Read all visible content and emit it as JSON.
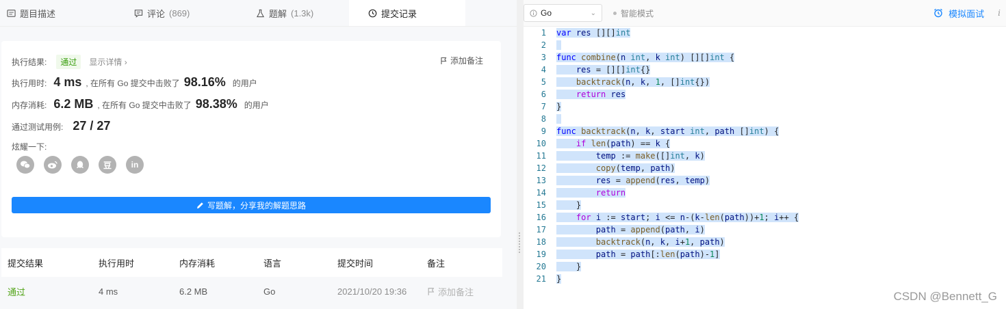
{
  "tabs": [
    {
      "label": "题目描述",
      "count": ""
    },
    {
      "label": "评论",
      "count": "(869)"
    },
    {
      "label": "题解",
      "count": "(1.3k)"
    },
    {
      "label": "提交记录",
      "count": ""
    }
  ],
  "result": {
    "result_label": "执行结果:",
    "result_value": "通过",
    "detail_link": "显示详情 ›",
    "add_note": "添加备注",
    "runtime_label": "执行用时:",
    "runtime_value": "4 ms",
    "runtime_text": ", 在所有 Go 提交中击败了",
    "runtime_percent": "98.16%",
    "runtime_suffix": "的用户",
    "memory_label": "内存消耗:",
    "memory_value": "6.2 MB",
    "memory_text": ", 在所有 Go 提交中击败了",
    "memory_percent": "98.38%",
    "memory_suffix": "的用户",
    "tests_label": "通过测试用例:",
    "tests_value": "27 / 27",
    "share_label": "炫耀一下:",
    "share_icons": [
      "wechat-icon",
      "weibo-icon",
      "qq-icon",
      "douban-icon",
      "linkedin-icon"
    ],
    "douban_glyph": "豆",
    "linkedin_glyph": "in",
    "write_button": "写题解，分享我的解题思路"
  },
  "table": {
    "headers": [
      "提交结果",
      "执行用时",
      "内存消耗",
      "语言",
      "提交时间",
      "备注"
    ],
    "rows": [
      {
        "result": "通过",
        "runtime": "4 ms",
        "memory": "6.2 MB",
        "language": "Go",
        "time": "2021/10/20 19:36",
        "note": "添加备注"
      }
    ]
  },
  "editor": {
    "language": "Go",
    "smart_mode": "智能模式",
    "mock_interview": "模拟面试",
    "info": "i"
  },
  "code_lines": [
    "var res [][]int",
    "",
    "func combine(n int, k int) [][]int {",
    "    res = [][]int{}",
    "    backtrack(n, k, 1, []int{})",
    "    return res",
    "}",
    "",
    "func backtrack(n, k, start int, path []int) {",
    "    if len(path) == k {",
    "        temp := make([]int, k)",
    "        copy(temp, path)",
    "        res = append(res, temp)",
    "        return",
    "    }",
    "    for i := start; i <= n-(k-len(path))+1; i++ {",
    "        path = append(path, i)",
    "        backtrack(n, k, i+1, path)",
    "        path = path[:len(path)-1]",
    "    }",
    "}"
  ],
  "watermark": "CSDN @Bennett_G",
  "colors": {
    "accent": "#1a87ff",
    "pass": "#52a317"
  }
}
